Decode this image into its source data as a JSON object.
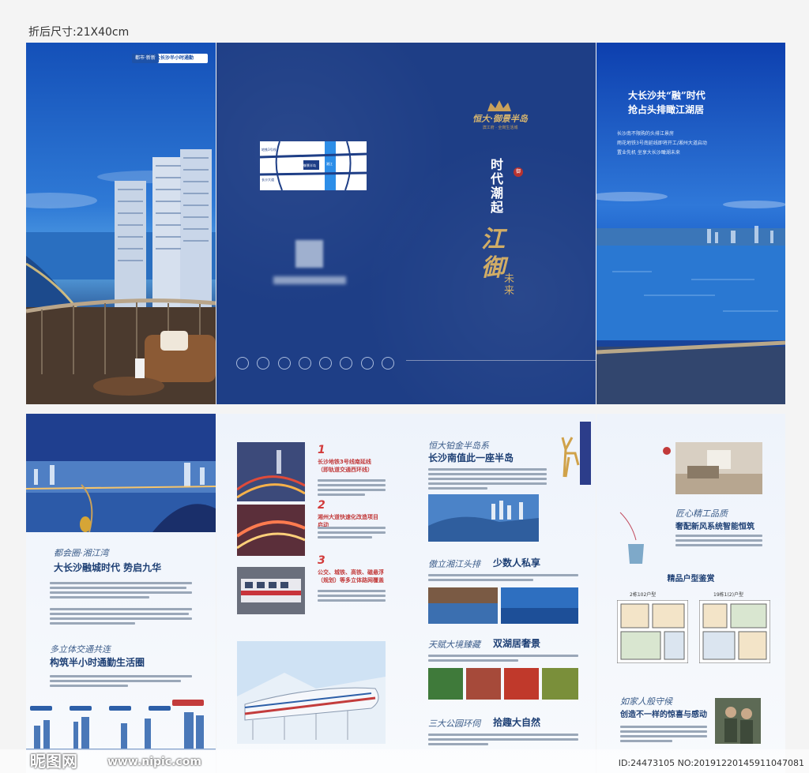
{
  "caption": "折后尺寸:21X40cm",
  "cover": {
    "logo_title": "恒大·御景半岛",
    "logo_sub": "滨江府 · 全岗生活城",
    "slogan_a": "时代潮起",
    "slogan_b": "江御",
    "slogan_c": "未来",
    "badge": "御",
    "map_labels": [
      "地铁3号线",
      "湘江",
      "长沙大道",
      "御景半岛"
    ]
  },
  "left_cover": {
    "tag1": "都市·新新",
    "tag2": "大长沙半小时通勤"
  },
  "right_cover": {
    "headline_1": "大长沙共“融”时代",
    "headline_2": "抢占头排瞰江湖居",
    "lines": [
      "长沙南不限购的头排江景房",
      "雨花地铁3号南延线即将开工/湘州大道启动",
      "置业先机 坐享大长沙瞰湖未来"
    ]
  },
  "inner_1": {
    "cal_1": "都会圈·湘江湾",
    "title_1": "大长沙融城时代 势启九华",
    "cal_2": "多立体交通共连",
    "title_2": "构筑半小时通勤生活圈"
  },
  "inner_2": {
    "items": [
      {
        "num": "1",
        "title": "长沙地铁3号线南延线（即轨道交通西环线）"
      },
      {
        "num": "2",
        "title": "湘州大道快速化改造项目启动"
      },
      {
        "num": "3",
        "title": "公交、城铁、高铁、磁悬浮（规划）等多立体路网覆盖"
      }
    ]
  },
  "inner_3": {
    "cal_1": "恒大铂金半岛系",
    "title_1": "长沙南值此一座半岛",
    "sec_2a": "傲立湘江头排",
    "sec_2b": "少数人私享",
    "sec_3a": "天赋大境臻藏",
    "sec_3b": "双湖居奢景",
    "sec_4a": "三大公园环伺",
    "sec_4b": "拾趣大自然"
  },
  "inner_4": {
    "cal_1": "匠心精工品质",
    "title_1": "奢配新风系统智能恒筑",
    "plan_header": "精品户型鉴赏",
    "plan_a": "2栋102户型",
    "plan_b": "19栋1(2)户型",
    "cal_2": "如家人般守候",
    "title_2": "创造不一样的惊喜与感动"
  },
  "watermark": {
    "brand": "昵图网",
    "url": "www.nipic.com",
    "id": "ID:24473105 NO:20191220145911047081"
  },
  "colors": {
    "cover_blue": "#1e3e86",
    "gold": "#c9a15b",
    "sky_blue": "#2f78d9",
    "accent_red": "#c23a3a"
  }
}
